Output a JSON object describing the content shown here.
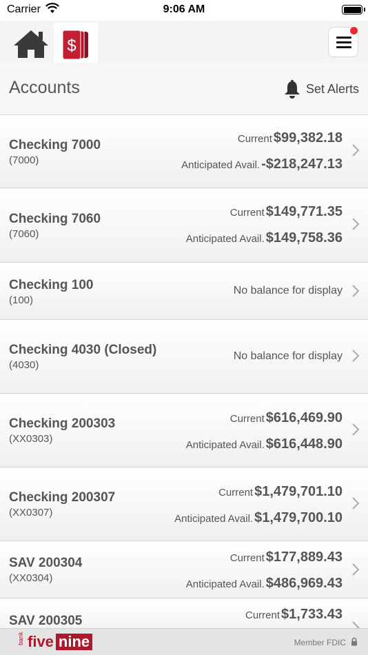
{
  "status_bar": {
    "carrier": "Carrier",
    "time": "9:06 AM"
  },
  "nav": {
    "home_icon": "home-icon",
    "accounts_icon": "dollar-cards-icon",
    "menu_icon": "hamburger-menu-icon",
    "badge_color": "#e8292f",
    "accent": "#b0172a"
  },
  "header": {
    "title": "Accounts",
    "alerts_label": "Set Alerts"
  },
  "accounts": [
    {
      "name": "Checking 7000",
      "number": "(7000)",
      "current_label": "Current",
      "current": "$99,382.18",
      "avail_label": "Anticipated Avail.",
      "avail": "-$218,247.13"
    },
    {
      "name": "Checking 7060",
      "number": "(7060)",
      "current_label": "Current",
      "current": "$149,771.35",
      "avail_label": "Anticipated Avail.",
      "avail": "$149,758.36"
    },
    {
      "name": "Checking 100",
      "number": "(100)",
      "no_balance": "No balance for display"
    },
    {
      "name": "Checking 4030 (Closed)",
      "number": "(4030)",
      "no_balance": "No balance for display"
    },
    {
      "name": "Checking 200303",
      "number": "(XX0303)",
      "current_label": "Current",
      "current": "$616,469.90",
      "avail_label": "Anticipated Avail.",
      "avail": "$616,448.90"
    },
    {
      "name": "Checking 200307",
      "number": "(XX0307)",
      "current_label": "Current",
      "current": "$1,479,701.10",
      "avail_label": "Anticipated Avail.",
      "avail": "$1,479,700.10"
    },
    {
      "name": "SAV 200304",
      "number": "(XX0304)",
      "current_label": "Current",
      "current": "$177,889.43",
      "avail_label": "Anticipated Avail.",
      "avail": "$486,969.43"
    },
    {
      "name": "SAV 200305",
      "number": "",
      "current_label": "Current",
      "current": "$1,733.43"
    }
  ],
  "footer": {
    "logo_bank": "bank",
    "logo_five": "five",
    "logo_nine": "nine",
    "member_fdic": "Member FDIC"
  }
}
